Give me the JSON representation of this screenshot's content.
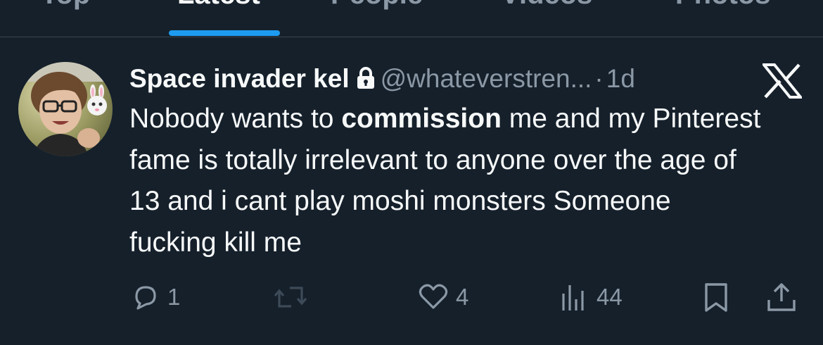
{
  "tabs": [
    {
      "label": "Top"
    },
    {
      "label": "Latest"
    },
    {
      "label": "People"
    },
    {
      "label": "Videos"
    },
    {
      "label": "Photos"
    }
  ],
  "active_tab": "Latest",
  "tweet": {
    "display_name": "Space invader kel",
    "handle": "@whateverstren...",
    "separator": "·",
    "time": "1d",
    "text_part1": "Nobody wants to ",
    "text_bold": "commission",
    "text_part2": " me and my Pinterest fame is totally irrelevant to anyone over the age of 13 and i cant play moshi monsters Someone fucking kill me",
    "replies": "1",
    "likes": "4",
    "views": "44"
  },
  "colors": {
    "background": "#15202b",
    "accent": "#1d9bf0",
    "secondary_text": "#8b98a5",
    "primary_text": "#f7f9f9"
  },
  "icons": [
    "lock-icon",
    "x-logo-icon",
    "reply-icon",
    "retweet-icon",
    "like-icon",
    "views-icon",
    "bookmark-icon",
    "share-icon"
  ]
}
